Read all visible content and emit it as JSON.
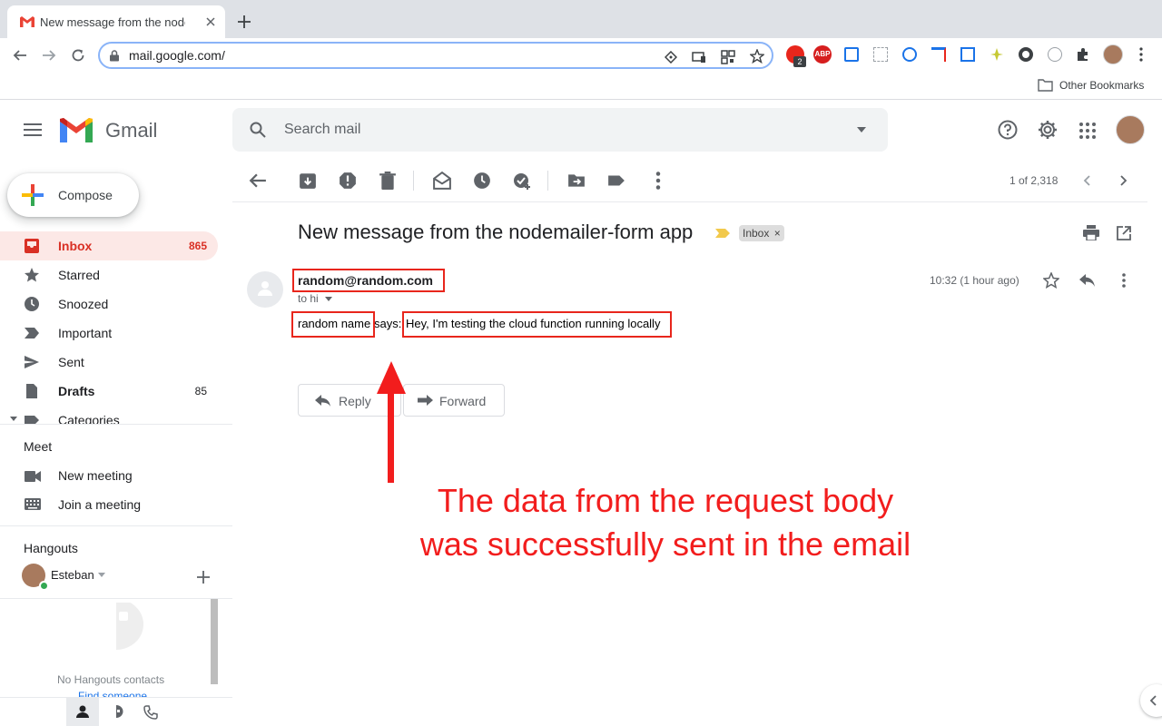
{
  "browser": {
    "tab_title": "New message from the nodem",
    "url": "mail.google.com/",
    "bookmark_folder": "Other Bookmarks",
    "extension_badge": "2",
    "abp_label": "ABP"
  },
  "gmail": {
    "logo_text": "Gmail",
    "search_placeholder": "Search mail",
    "compose_label": "Compose",
    "nav": [
      {
        "label": "Inbox",
        "count": "865",
        "icon": "inbox-icon"
      },
      {
        "label": "Starred",
        "count": "",
        "icon": "star-icon"
      },
      {
        "label": "Snoozed",
        "count": "",
        "icon": "clock-icon"
      },
      {
        "label": "Important",
        "count": "",
        "icon": "important-icon"
      },
      {
        "label": "Sent",
        "count": "",
        "icon": "send-icon"
      },
      {
        "label": "Drafts",
        "count": "85",
        "icon": "draft-icon"
      },
      {
        "label": "Categories",
        "count": "",
        "icon": "label-icon"
      }
    ],
    "meet": {
      "heading": "Meet",
      "new_meeting": "New meeting",
      "join_meeting": "Join a meeting"
    },
    "hangouts": {
      "heading": "Hangouts",
      "user": "Esteban",
      "empty_text": "No Hangouts contacts",
      "find_link": "Find someone"
    },
    "pagination": "1 of 2,318",
    "message": {
      "subject": "New message from the nodemailer-form app",
      "label_chip": "Inbox",
      "label_chip_close": "×",
      "sender": "random@random.com",
      "to_line": "to hi",
      "time": "10:32 (1 hour ago)",
      "body_name": "random name",
      "body_says": "says:",
      "body_text": "Hey, I'm testing the cloud function running locally",
      "reply_label": "Reply",
      "forward_label": "Forward"
    }
  },
  "annotation": {
    "line1": "The data from the request body",
    "line2": "was successfully sent in the email",
    "color": "#f21d1d"
  }
}
